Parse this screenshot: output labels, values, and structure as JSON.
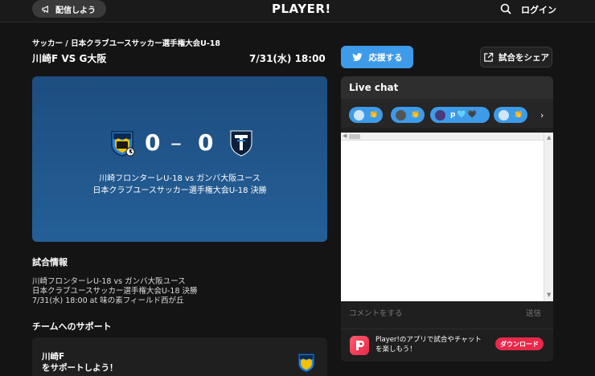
{
  "header": {
    "publish_label": "配信しよう",
    "logo": "PLAYER!",
    "login_label": "ログイン"
  },
  "match": {
    "breadcrumb": "サッカー / 日本クラブユースサッカー選手権大会U-18",
    "title": "川崎F VS G大阪",
    "datetime": "7/31(水) 18:00",
    "cheer_label": "応援する",
    "share_label": "試合をシェア"
  },
  "scoreboard": {
    "home_score": "0",
    "separator": "–",
    "away_score": "0",
    "line1": "川崎フロンターレU-18 vs ガンバ大阪ユース",
    "line2": "日本クラブユースサッカー選手権大会U-18 決勝"
  },
  "info": {
    "title": "試合情報",
    "lines": [
      "川崎フロンターレU-18 vs ガンバ大阪ユース",
      "日本クラブユースサッカー選手権大会U-18 決勝",
      "7/31(水) 18:00 at 味の素フィールド西が丘"
    ]
  },
  "support": {
    "title": "チームへのサポート",
    "card_line1": "川崎F",
    "card_line2": "をサポートしよう！"
  },
  "chat": {
    "title": "Live chat",
    "comment_placeholder": "コメントをする",
    "send_label": "送信",
    "app_line1": "Player!のアプリで試合やチャット",
    "app_line2": "を楽しもう！",
    "download_label": "ダウンロード"
  },
  "colors": {
    "accent": "#3d9be9",
    "download": "#e8294a",
    "background": "#141414"
  }
}
